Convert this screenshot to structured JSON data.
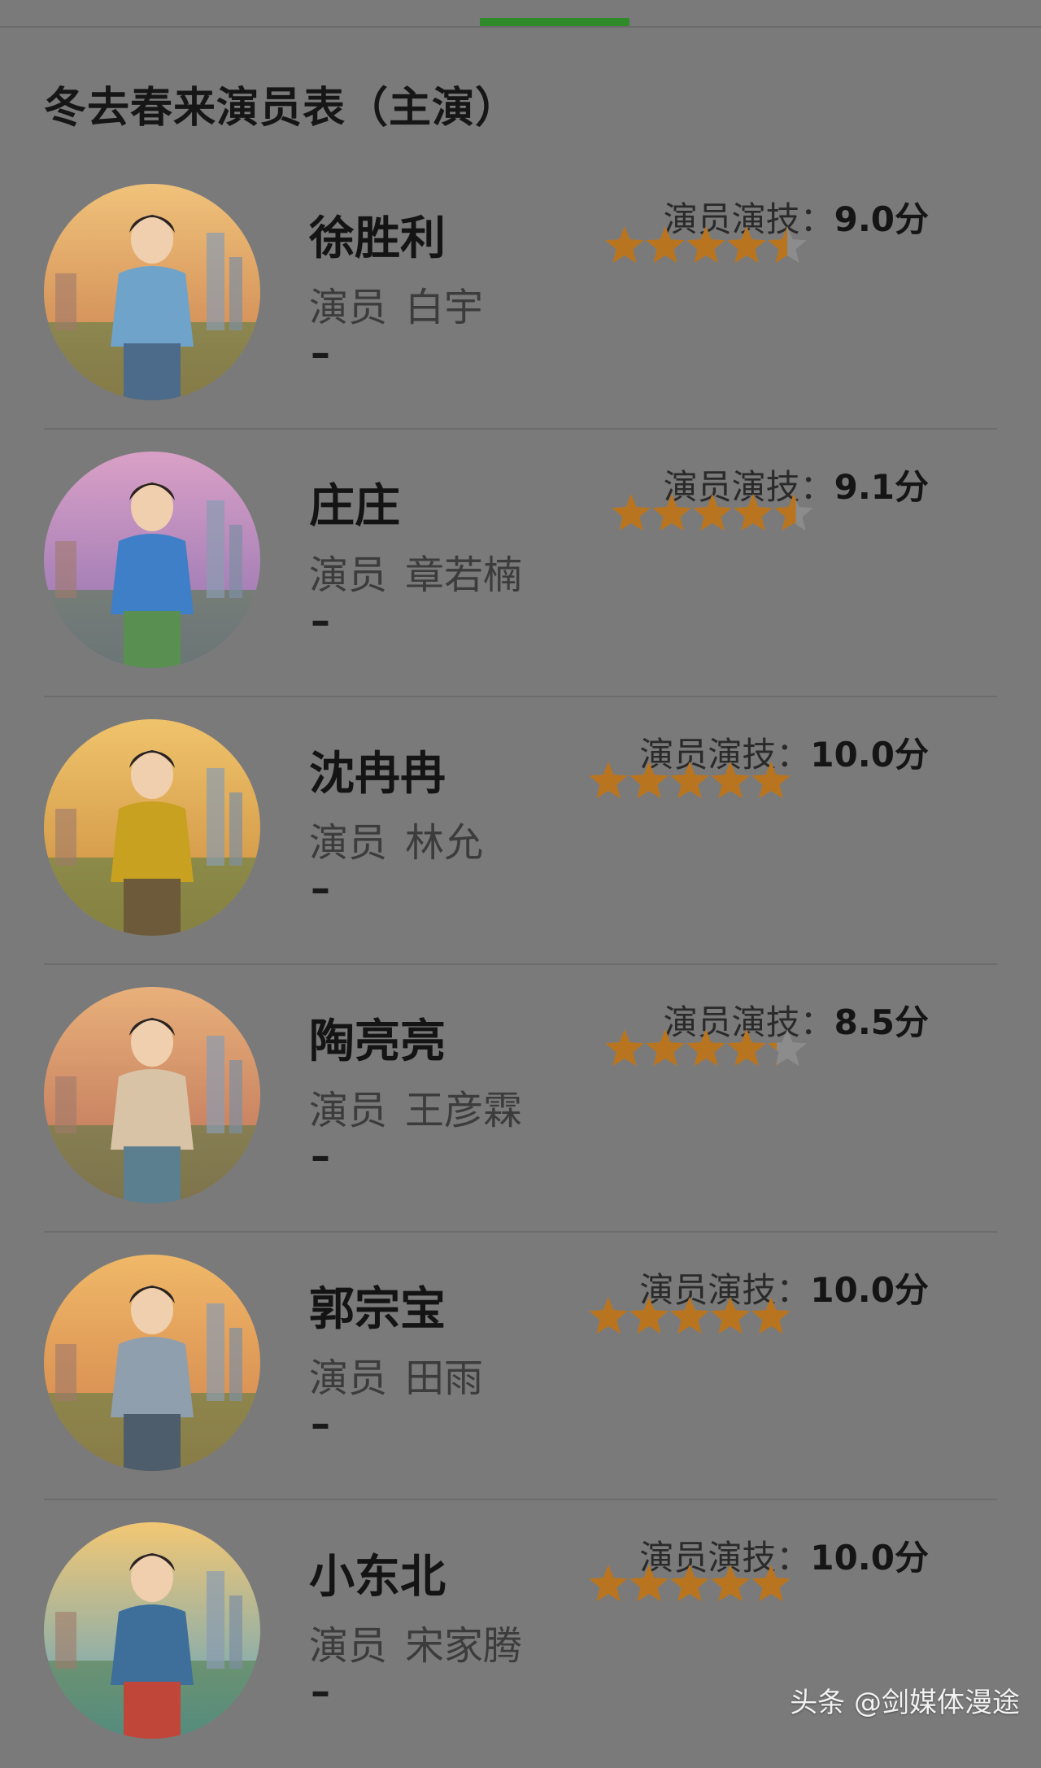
{
  "title": "冬去春来演员表（主演）",
  "label_actor": "演员",
  "label_rating": "演员演技：",
  "dash": "–",
  "star_color": "#b8741e",
  "star_empty_color": "#8c8c8c",
  "watermark": "头条 @剑媒体漫途",
  "cast": [
    {
      "role": "徐胜利",
      "actor": "白宇",
      "score": "9.0分",
      "rating": 9.0
    },
    {
      "role": "庄庄",
      "actor": "章若楠",
      "score": "9.1分",
      "rating": 9.1
    },
    {
      "role": "沈冉冉",
      "actor": "林允",
      "score": "10.0分",
      "rating": 10.0
    },
    {
      "role": "陶亮亮",
      "actor": "王彦霖",
      "score": "8.5分",
      "rating": 8.5
    },
    {
      "role": "郭宗宝",
      "actor": "田雨",
      "score": "10.0分",
      "rating": 10.0
    },
    {
      "role": "小东北",
      "actor": "宋家腾",
      "score": "10.0分",
      "rating": 10.0
    }
  ]
}
